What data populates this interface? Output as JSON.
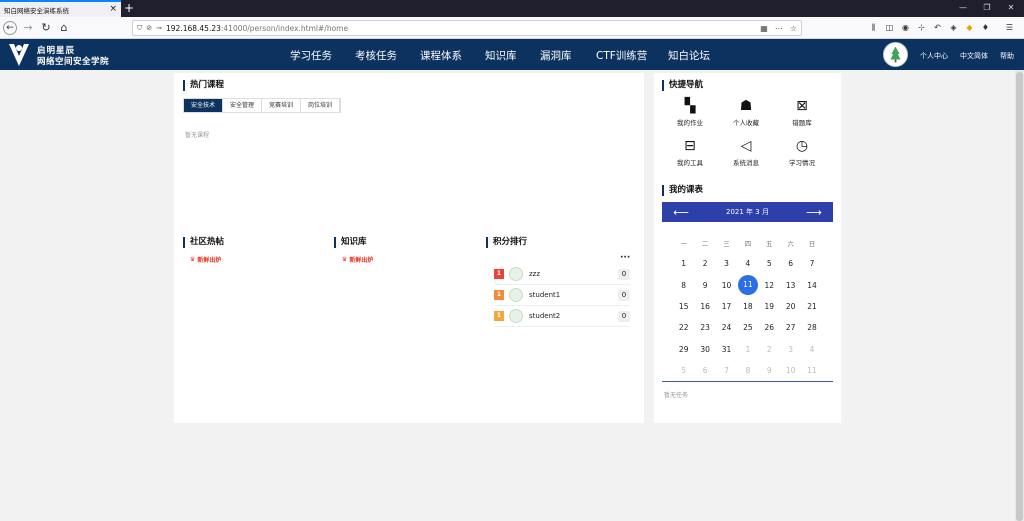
{
  "browser": {
    "tab_title": "知白网络安全演练系统",
    "tab_close": "×",
    "new_tab": "+",
    "url_host": "192.168.45.23",
    "url_path": ":41000/person/index.html#/home",
    "window_buttons": [
      "—",
      "❐",
      "✕"
    ]
  },
  "site": {
    "brand_line1": "启明星辰",
    "brand_line2": "网络空间安全学院",
    "nav": [
      "学习任务",
      "考核任务",
      "课程体系",
      "知识库",
      "漏洞库",
      "CTF训练营",
      "知白论坛"
    ],
    "header_links": [
      "个人中心",
      "中文简体",
      "帮助"
    ]
  },
  "hot_courses": {
    "title": "热门课程",
    "tabs": [
      "安全技术",
      "安全管理",
      "竞赛培训",
      "岗位培训"
    ],
    "active_tab": 0,
    "empty_text": "暂无课程"
  },
  "community": {
    "title": "社区热帖",
    "badge": "新鲜出炉"
  },
  "knowledge": {
    "title": "知识库",
    "badge": "新鲜出炉"
  },
  "ranking": {
    "title": "积分排行",
    "more": "···",
    "rows": [
      {
        "rank": "1",
        "name": "zzz",
        "score": "0",
        "color": "#e8443a"
      },
      {
        "rank": "1",
        "name": "student1",
        "score": "0",
        "color": "#f08a3c"
      },
      {
        "rank": "1",
        "name": "student2",
        "score": "0",
        "color": "#f0a83c"
      }
    ]
  },
  "quick_nav": {
    "title": "快捷导航",
    "items": [
      {
        "label": "我的作业",
        "icon": "homework-icon",
        "glyph": "▚"
      },
      {
        "label": "个人收藏",
        "icon": "favorite-icon",
        "glyph": "☗"
      },
      {
        "label": "错题库",
        "icon": "wrong-questions-icon",
        "glyph": "⊠"
      },
      {
        "label": "我的工具",
        "icon": "toolbox-icon",
        "glyph": "⊟"
      },
      {
        "label": "系统消息",
        "icon": "megaphone-icon",
        "glyph": "◁"
      },
      {
        "label": "学习情况",
        "icon": "history-icon",
        "glyph": "◷"
      }
    ]
  },
  "schedule": {
    "title": "我的课表",
    "prev": "⟵",
    "next": "⟶",
    "month_label": "2021 年 3 月",
    "weekdays": [
      "一",
      "二",
      "三",
      "四",
      "五",
      "六",
      "日"
    ],
    "weeks": [
      [
        "1",
        "2",
        "3",
        "4",
        "5",
        "6",
        "7"
      ],
      [
        "8",
        "9",
        "10",
        "11",
        "12",
        "13",
        "14"
      ],
      [
        "15",
        "16",
        "17",
        "18",
        "19",
        "20",
        "21"
      ],
      [
        "22",
        "23",
        "24",
        "25",
        "26",
        "27",
        "28"
      ],
      [
        "29",
        "30",
        "31",
        "1",
        "2",
        "3",
        "4"
      ],
      [
        "5",
        "6",
        "7",
        "8",
        "9",
        "10",
        "11"
      ]
    ],
    "today": "11",
    "empty_text": "暂无任务"
  }
}
